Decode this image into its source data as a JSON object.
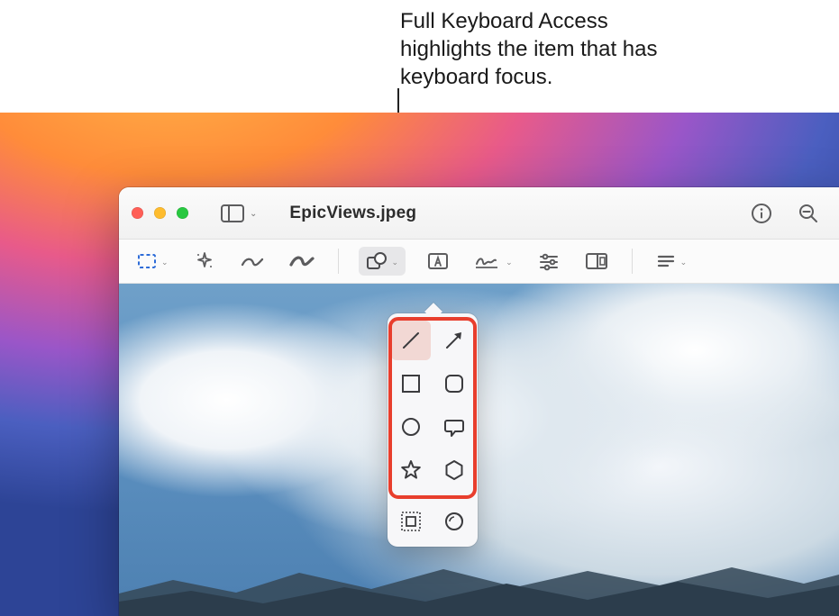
{
  "callout": "Full Keyboard Access highlights the item that has keyboard focus.",
  "window": {
    "filename": "EpicViews.jpeg"
  },
  "traffic_lights": {
    "close": "close",
    "minimize": "minimize",
    "zoom": "zoom"
  },
  "titlebar": {
    "sidebar_icon": "sidebar",
    "info_icon": "info",
    "zoom_out_icon": "zoom-out"
  },
  "toolbar": {
    "selection": "rectangular-selection",
    "magic": "instant-alpha",
    "sketch": "sketch",
    "draw": "draw",
    "shapes": "shapes",
    "text": "text",
    "sign": "signature",
    "adjust": "adjust-color",
    "crop": "adjust-size",
    "desc": "description"
  },
  "shapes_popover": {
    "items": [
      "line",
      "arrow",
      "rectangle",
      "rounded-rectangle",
      "oval",
      "speech-bubble",
      "star",
      "hexagon"
    ],
    "selected": "line",
    "styles": [
      "fill-style",
      "stroke-style"
    ]
  }
}
